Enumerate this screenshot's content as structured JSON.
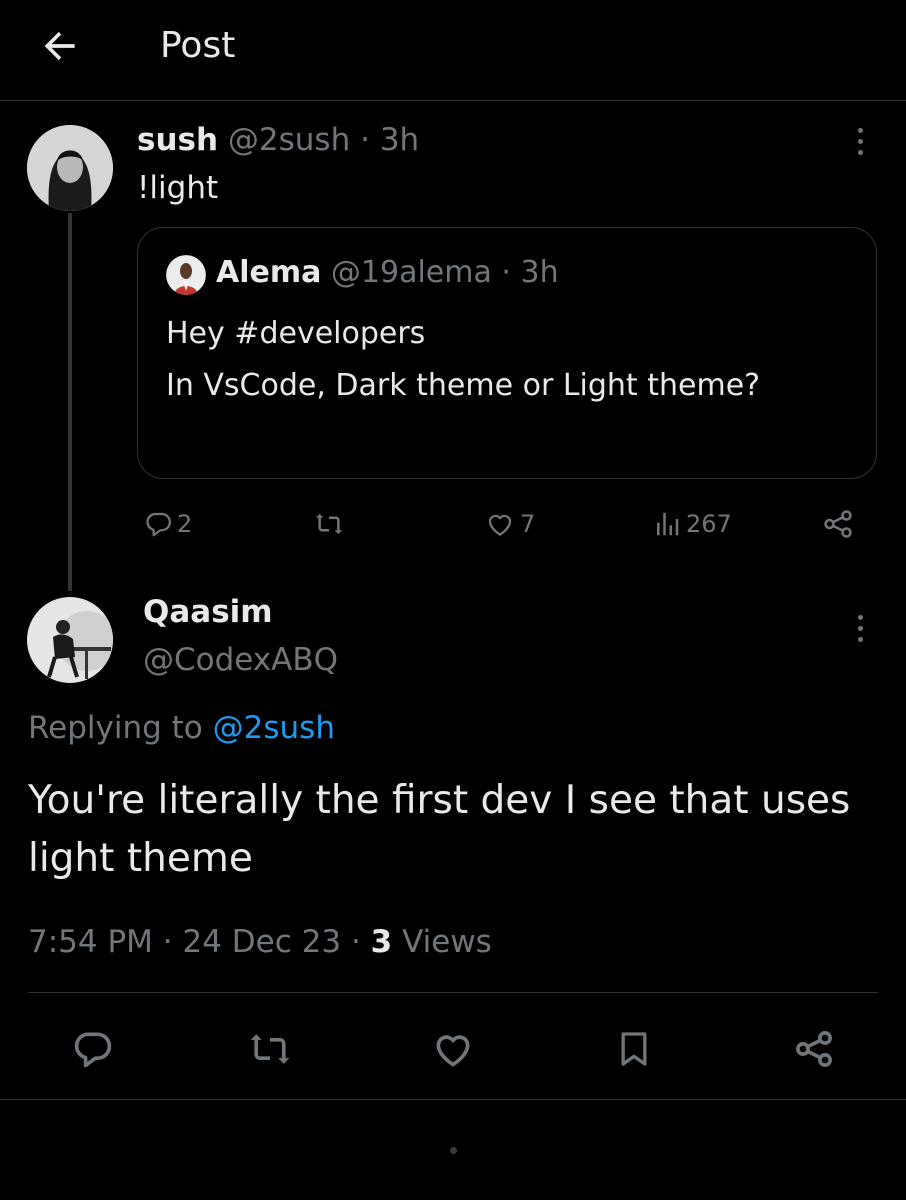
{
  "header": {
    "title": "Post",
    "back_icon": "arrow-left-icon"
  },
  "post1": {
    "author_name": "sush",
    "handle": "@2sush",
    "separator": "·",
    "time": "3h",
    "text": "!light",
    "quote": {
      "author_name": "Alema",
      "handle": "@19alema",
      "time": "3h",
      "text": "Hey #developers\nIn VsCode,  Dark theme or Light theme?"
    },
    "stats": {
      "replies": "2",
      "likes": "7",
      "views": "267"
    }
  },
  "post2": {
    "author_name": "Qaasim",
    "handle": "@CodexABQ",
    "replying_prefix": "Replying to",
    "replying_to": "@2sush",
    "text": "You're literally the first dev I see that uses light theme",
    "time": "7:54 PM",
    "date": "24 Dec 23",
    "views_count": "3",
    "views_label": "Views"
  },
  "colors": {
    "background": "#000000",
    "text": "#e7e9ea",
    "muted": "#71767b",
    "link": "#1d9bf0",
    "border": "#2f3336"
  }
}
